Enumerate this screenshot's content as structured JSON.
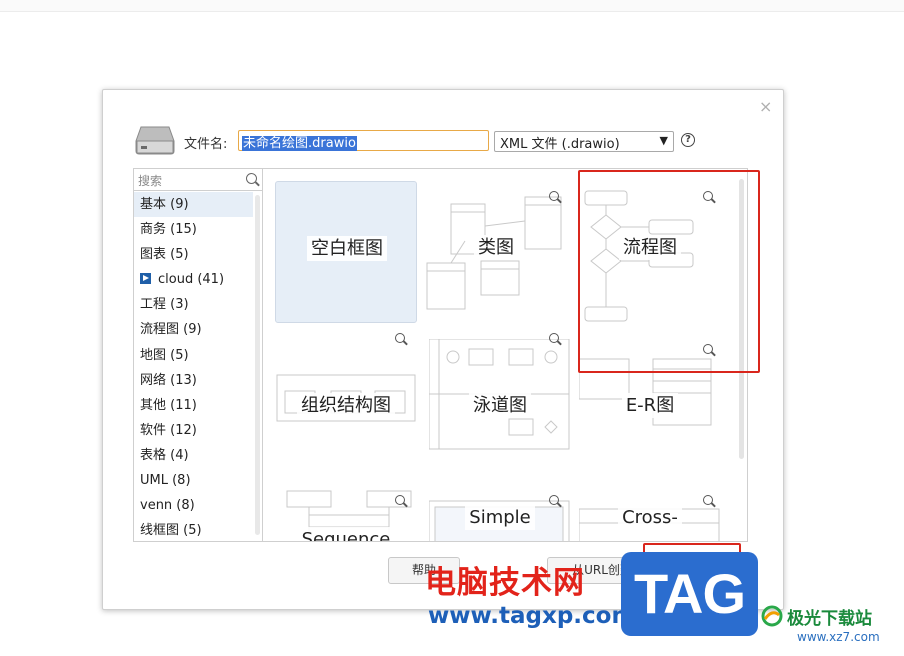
{
  "dialog": {
    "close_icon": "×",
    "filename_label": "文件名:",
    "filename_value": "未命名绘图.drawio",
    "format_selected": "XML 文件 (.drawio)",
    "help_icon": "?"
  },
  "sidebar": {
    "search_placeholder": "搜索",
    "categories": [
      {
        "label": "基本 (9)"
      },
      {
        "label": "商务 (15)"
      },
      {
        "label": "图表 (5)"
      },
      {
        "label": "cloud (41)"
      },
      {
        "label": "工程 (3)"
      },
      {
        "label": "流程图 (9)"
      },
      {
        "label": "地图 (5)"
      },
      {
        "label": "网络 (13)"
      },
      {
        "label": "其他 (11)"
      },
      {
        "label": "软件 (12)"
      },
      {
        "label": "表格 (4)"
      },
      {
        "label": "UML (8)"
      },
      {
        "label": "venn (8)"
      },
      {
        "label": "线框图 (5)"
      }
    ]
  },
  "templates": [
    {
      "label": "空白框图"
    },
    {
      "label": "类图"
    },
    {
      "label": "流程图"
    },
    {
      "label": "组织结构图"
    },
    {
      "label": "泳道图"
    },
    {
      "label": "E-R图"
    },
    {
      "label": "Sequence"
    },
    {
      "label": "Simple"
    },
    {
      "label": "Cross-"
    }
  ],
  "buttons": {
    "help": "帮助",
    "from_url": "从URL创建"
  },
  "watermark": {
    "cn": "电脑技术网",
    "url": "www.tagxp.com",
    "tag": "TAG",
    "site": "极光下载站",
    "site_url": "www.xz7.com"
  },
  "colors": {
    "highlight_red": "#d9261c",
    "selection_blue": "#3a74d8",
    "active_category_bg": "#e6eef7"
  }
}
